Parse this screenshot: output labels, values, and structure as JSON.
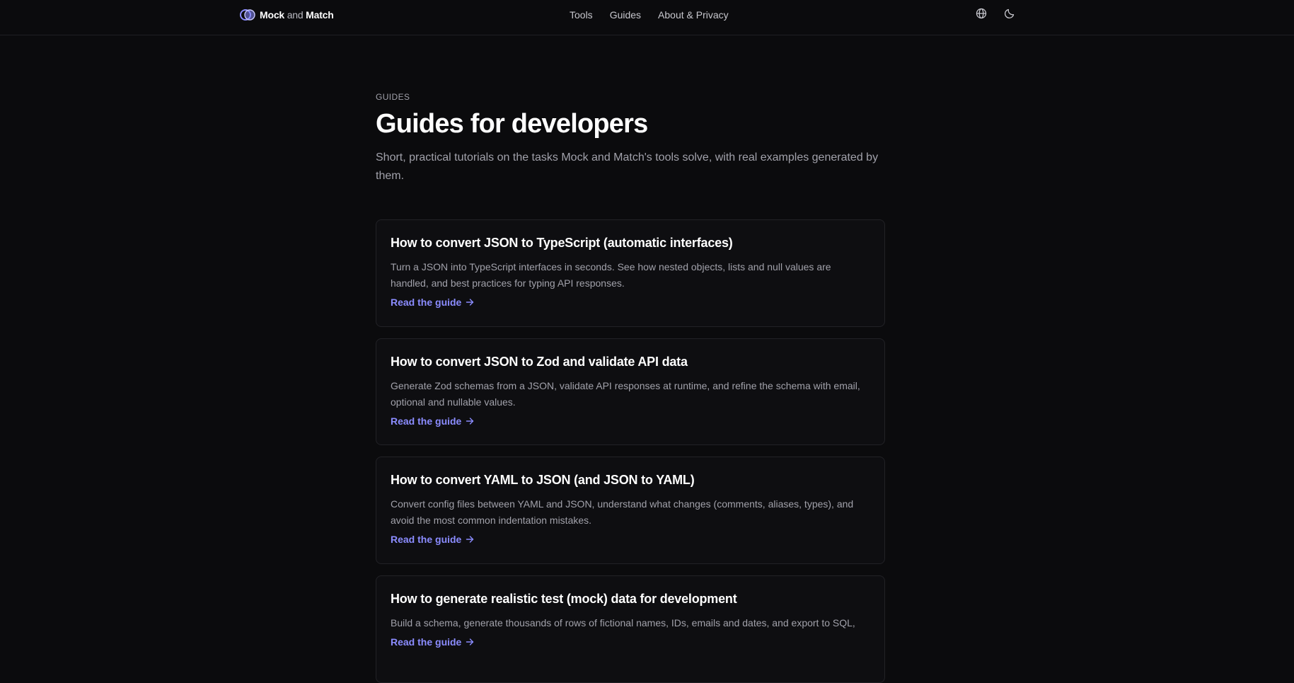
{
  "colors": {
    "background": "#0b0b0d",
    "card_background": "#0e0e11",
    "card_border": "#222226",
    "accent": "#8b8cff",
    "text_primary": "#ffffff",
    "text_muted": "#a1a1aa"
  },
  "header": {
    "brand": {
      "logo_icon": "logo-icon",
      "part1": "Mock",
      "part2": "and",
      "part3": "Match"
    },
    "nav": [
      {
        "label": "Tools"
      },
      {
        "label": "Guides"
      },
      {
        "label": "About & Privacy"
      }
    ],
    "actions": {
      "language_icon": "globe-icon",
      "theme_icon": "moon-icon"
    }
  },
  "main": {
    "eyebrow": "GUIDES",
    "title": "Guides for developers",
    "subtitle": "Short, practical tutorials on the tasks Mock and Match's tools solve, with real examples generated by them.",
    "guides": [
      {
        "title": "How to convert JSON to TypeScript (automatic interfaces)",
        "description": "Turn a JSON into TypeScript interfaces in seconds. See how nested objects, lists and null values are handled, and best practices for typing API responses.",
        "link_label": "Read the guide"
      },
      {
        "title": "How to convert JSON to Zod and validate API data",
        "description": "Generate Zod schemas from a JSON, validate API responses at runtime, and refine the schema with email, optional and nullable values.",
        "link_label": "Read the guide"
      },
      {
        "title": "How to convert YAML to JSON (and JSON to YAML)",
        "description": "Convert config files between YAML and JSON, understand what changes (comments, aliases, types), and avoid the most common indentation mistakes.",
        "link_label": "Read the guide"
      },
      {
        "title": "How to generate realistic test (mock) data for development",
        "description": "Build a schema, generate thousands of rows of fictional names, IDs, emails and dates, and export to SQL,",
        "link_label": "Read the guide"
      }
    ]
  }
}
